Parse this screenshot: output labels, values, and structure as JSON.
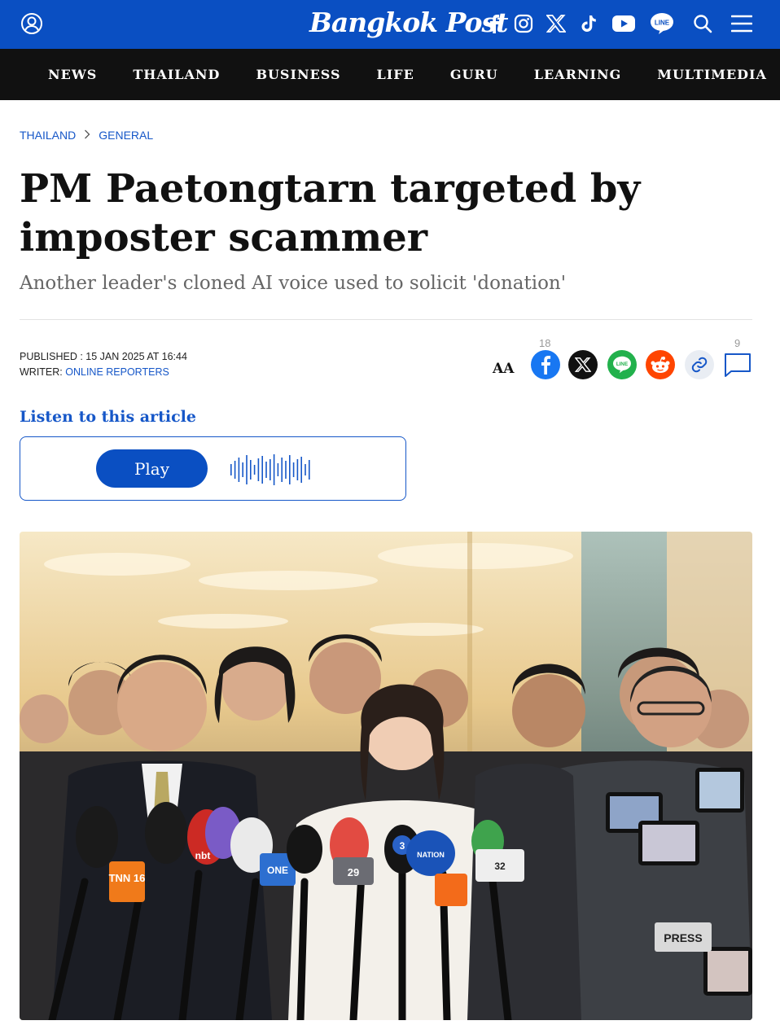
{
  "header": {
    "logo_text": "Bangkok Post",
    "icons": [
      "user-icon",
      "facebook-icon",
      "instagram-icon",
      "x-icon",
      "tiktok-icon",
      "youtube-icon",
      "line-icon",
      "search-icon",
      "menu-icon"
    ],
    "line_badge": "LINE",
    "brand_color": "#0a4fc2"
  },
  "nav": {
    "items": [
      "NEWS",
      "THAILAND",
      "BUSINESS",
      "LIFE",
      "GURU",
      "LEARNING",
      "MULTIMEDIA"
    ]
  },
  "breadcrumb": {
    "section": "THAILAND",
    "subsection": "GENERAL"
  },
  "article": {
    "title": "PM Paetongtarn targeted by imposter scammer",
    "subtitle": "Another leader's cloned AI voice used to solicit 'donation'",
    "published_label": "PUBLISHED : ",
    "published_value": "15 JAN 2025 AT 16:44",
    "writer_label": "WRITER: ",
    "writer_value": "ONLINE REPORTERS"
  },
  "share": {
    "font_size_label": "AA",
    "facebook_count": "18",
    "comment_count": "9",
    "line_badge": "LINE"
  },
  "audio": {
    "label": "Listen to this article",
    "play_label": "Play"
  },
  "hero_image": {
    "mic_tags": [
      "TNN 16",
      "nbt",
      "ONE",
      "29",
      "3",
      "NATION",
      "32"
    ],
    "press_tag": "PRESS"
  }
}
